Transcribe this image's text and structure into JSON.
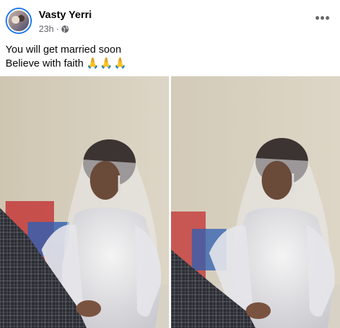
{
  "post": {
    "author": "Vasty Yerri",
    "time": "23h",
    "separator": "·",
    "privacy_icon": "globe-icon",
    "more_icon": "more-options-icon",
    "more_label": "•••",
    "text_line1": "You will get married soon",
    "text_line2": "Believe with faith",
    "emoji": "🙏🙏🙏",
    "photos": [
      {
        "name": "bride-photo-1"
      },
      {
        "name": "bride-photo-2"
      }
    ]
  },
  "colors": {
    "accent": "#1877f2",
    "text": "#050505",
    "secondary_text": "#65676b"
  }
}
